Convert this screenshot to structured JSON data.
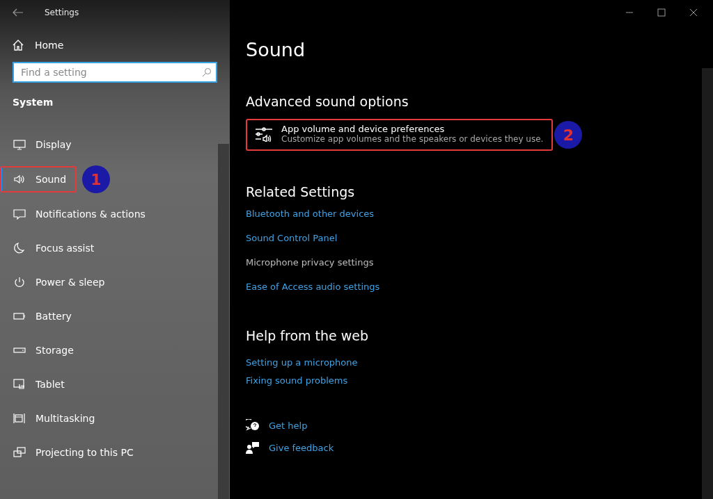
{
  "window": {
    "title": "Settings"
  },
  "sidebar": {
    "home": "Home",
    "search": {
      "placeholder": "Find a setting"
    },
    "section": "System",
    "items": [
      {
        "label": "Display",
        "selected": false
      },
      {
        "label": "Sound",
        "selected": true,
        "callout": "1"
      },
      {
        "label": "Notifications & actions",
        "selected": false
      },
      {
        "label": "Focus assist",
        "selected": false
      },
      {
        "label": "Power & sleep",
        "selected": false
      },
      {
        "label": "Battery",
        "selected": false
      },
      {
        "label": "Storage",
        "selected": false
      },
      {
        "label": "Tablet",
        "selected": false
      },
      {
        "label": "Multitasking",
        "selected": false
      },
      {
        "label": "Projecting to this PC",
        "selected": false
      }
    ]
  },
  "page": {
    "title": "Sound",
    "advanced": {
      "heading": "Advanced sound options",
      "option": {
        "title": "App volume and device preferences",
        "description": "Customize app volumes and the speakers or devices they use.",
        "callout": "2"
      }
    },
    "related": {
      "heading": "Related Settings",
      "links": [
        {
          "label": "Bluetooth and other devices",
          "disabled": false
        },
        {
          "label": "Sound Control Panel",
          "disabled": false
        },
        {
          "label": "Microphone privacy settings",
          "disabled": true
        },
        {
          "label": "Ease of Access audio settings",
          "disabled": false
        }
      ]
    },
    "help": {
      "heading": "Help from the web",
      "links": [
        "Setting up a microphone",
        "Fixing sound problems"
      ]
    },
    "footer": [
      "Get help",
      "Give feedback"
    ]
  }
}
